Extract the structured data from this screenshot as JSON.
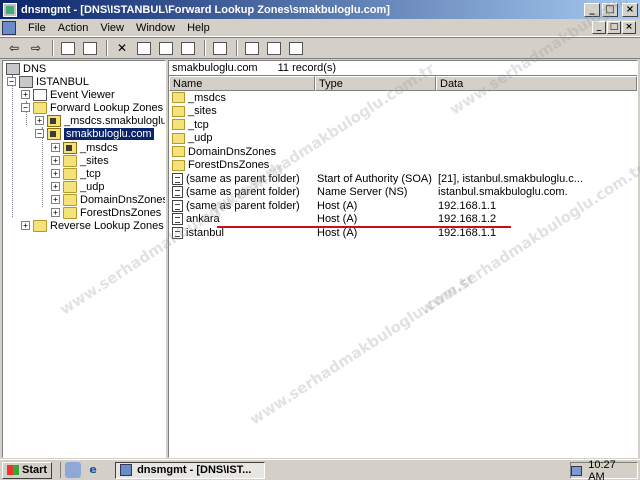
{
  "window": {
    "title": "dnsmgmt - [DNS\\ISTANBUL\\Forward Lookup Zones\\smakbuloglu.com]",
    "btn_min": "_",
    "btn_max": "□",
    "btn_close": "×",
    "mdi_min": "_",
    "mdi_max": "□",
    "mdi_close": "×"
  },
  "menu": [
    "File",
    "Action",
    "View",
    "Window",
    "Help"
  ],
  "toolbar": {
    "back_icon": "back-arrow-icon",
    "fwd_icon": "forward-arrow-icon",
    "back": "⇦",
    "forward": "⇨",
    "delete": "✕"
  },
  "tree": {
    "root": "DNS",
    "server": "ISTANBUL",
    "event_viewer": "Event Viewer",
    "forward": "Forward Lookup Zones",
    "msdcs_zone": "_msdcs.smakbuloglu.com",
    "zone": "smakbuloglu.com",
    "children": [
      "_msdcs",
      "_sites",
      "_tcp",
      "_udp",
      "DomainDnsZones",
      "ForestDnsZones"
    ],
    "reverse": "Reverse Lookup Zones",
    "expand_plus": "+",
    "expand_minus": "−"
  },
  "details": {
    "zone_name": "smakbuloglu.com",
    "record_count": "11 record(s)",
    "columns": [
      "Name",
      "Type",
      "Data"
    ],
    "rows": [
      {
        "name": "_msdcs",
        "type": "",
        "data": "",
        "kind": "folder"
      },
      {
        "name": "_sites",
        "type": "",
        "data": "",
        "kind": "folder"
      },
      {
        "name": "_tcp",
        "type": "",
        "data": "",
        "kind": "folder"
      },
      {
        "name": "_udp",
        "type": "",
        "data": "",
        "kind": "folder"
      },
      {
        "name": "DomainDnsZones",
        "type": "",
        "data": "",
        "kind": "folder"
      },
      {
        "name": "ForestDnsZones",
        "type": "",
        "data": "",
        "kind": "folder"
      },
      {
        "name": "(same as parent folder)",
        "type": "Start of Authority (SOA)",
        "data": "[21], istanbul.smakbuloglu.c...",
        "kind": "record"
      },
      {
        "name": "(same as parent folder)",
        "type": "Name Server (NS)",
        "data": "istanbul.smakbuloglu.com.",
        "kind": "record"
      },
      {
        "name": "(same as parent folder)",
        "type": "Host (A)",
        "data": "192.168.1.1",
        "kind": "record"
      },
      {
        "name": "ankara",
        "type": "Host (A)",
        "data": "192.168.1.2",
        "kind": "record"
      },
      {
        "name": "istanbul",
        "type": "Host (A)",
        "data": "192.168.1.1",
        "kind": "record"
      }
    ]
  },
  "taskbar": {
    "start": "Start",
    "task": "dnsmgmt - [DNS\\IST...",
    "clock": "10:27 AM"
  },
  "watermark": "www.serhadmakbuloglu.com.tr",
  "colors": {
    "title_start": "#0a246a",
    "title_end": "#a6caf0",
    "highlight_line": "#c8101a"
  }
}
